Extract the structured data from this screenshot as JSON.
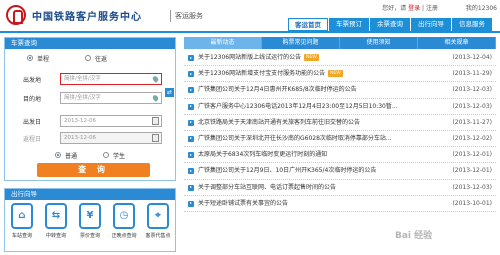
{
  "header": {
    "site_name": "中国铁路客户服务中心",
    "subtitle": "客运服务",
    "welcome": "您好，请",
    "login": "登录",
    "register": "注册",
    "user_text": "我的12306"
  },
  "nav": {
    "items": [
      {
        "label": "客运首页"
      },
      {
        "label": "车票预订"
      },
      {
        "label": "余票查询"
      },
      {
        "label": "出行向导"
      },
      {
        "label": "信息服务"
      }
    ]
  },
  "ticket": {
    "title": "车票查询",
    "trip_single": "单程",
    "trip_round": "往返",
    "from_label": "出发地",
    "from_placeholder": "简拼/全拼/汉字",
    "to_label": "目的地",
    "to_placeholder": "简拼/全拼/汉字",
    "date_label": "出发日",
    "date_value": "2013-12-06",
    "return_label": "返程日",
    "return_value": "2013-12-06",
    "type_normal": "普通",
    "type_student": "学生",
    "query_button": "查 询",
    "swap_icon": "⇄"
  },
  "guide": {
    "title": "出行向导",
    "items": [
      {
        "label": "车站查询",
        "icon": "station-icon",
        "glyph": "⌂"
      },
      {
        "label": "中转查询",
        "icon": "transfer-icon",
        "glyph": "⇆"
      },
      {
        "label": "票价查询",
        "icon": "price-icon",
        "glyph": "¥"
      },
      {
        "label": "正晚点查询",
        "icon": "clock-icon",
        "glyph": "◷"
      },
      {
        "label": "客票代售点",
        "icon": "agency-icon",
        "glyph": "⌖"
      }
    ]
  },
  "news": {
    "tabs": [
      {
        "label": "最新动态"
      },
      {
        "label": "购票常见问题"
      },
      {
        "label": "使用须知"
      },
      {
        "label": "相关规章"
      }
    ],
    "items": [
      {
        "title": "关于12306网站新版上线试运行的公告",
        "badge": "NEW",
        "date": "(2013-12-04)"
      },
      {
        "title": "关于12306网站新增支付宝支付服务功能的公告",
        "badge": "NEW",
        "date": "(2013-11-29)"
      },
      {
        "title": "广铁集团公司关于12月4日惠州开K685/8次临时停运的公告",
        "badge": "",
        "date": "(2013-12-03)"
      },
      {
        "title": "广铁客户服务中心12306电话2013年12月4日23:00至12月5日10:30暂...",
        "badge": "",
        "date": "(2013-12-03)"
      },
      {
        "title": "北京铁路局关于天津南站开通有关旅客列车前往旧交替的公告",
        "badge": "",
        "date": "(2013-11-27)"
      },
      {
        "title": "广铁集团公司关于深圳北开往长沙南的G6028次临时取消停靠部分车站...",
        "badge": "",
        "date": "(2013-12-02)"
      },
      {
        "title": "太原局关于6834次列车临时变更运行时刻的通知",
        "badge": "",
        "date": "(2013-12-01)"
      },
      {
        "title": "广铁集团公司关于12月9日、10日广州开K365/4次临时停运的公告",
        "badge": "",
        "date": "(2013-12-01)"
      },
      {
        "title": "关于调整部分车站互联网、电话订票起售时间的公告",
        "badge": "",
        "date": "(2013-12-03)"
      },
      {
        "title": "关于短途卧铺试票有关事宜的公告",
        "badge": "",
        "date": "(2013-10-01)"
      }
    ]
  },
  "watermark": "Bai 经验"
}
